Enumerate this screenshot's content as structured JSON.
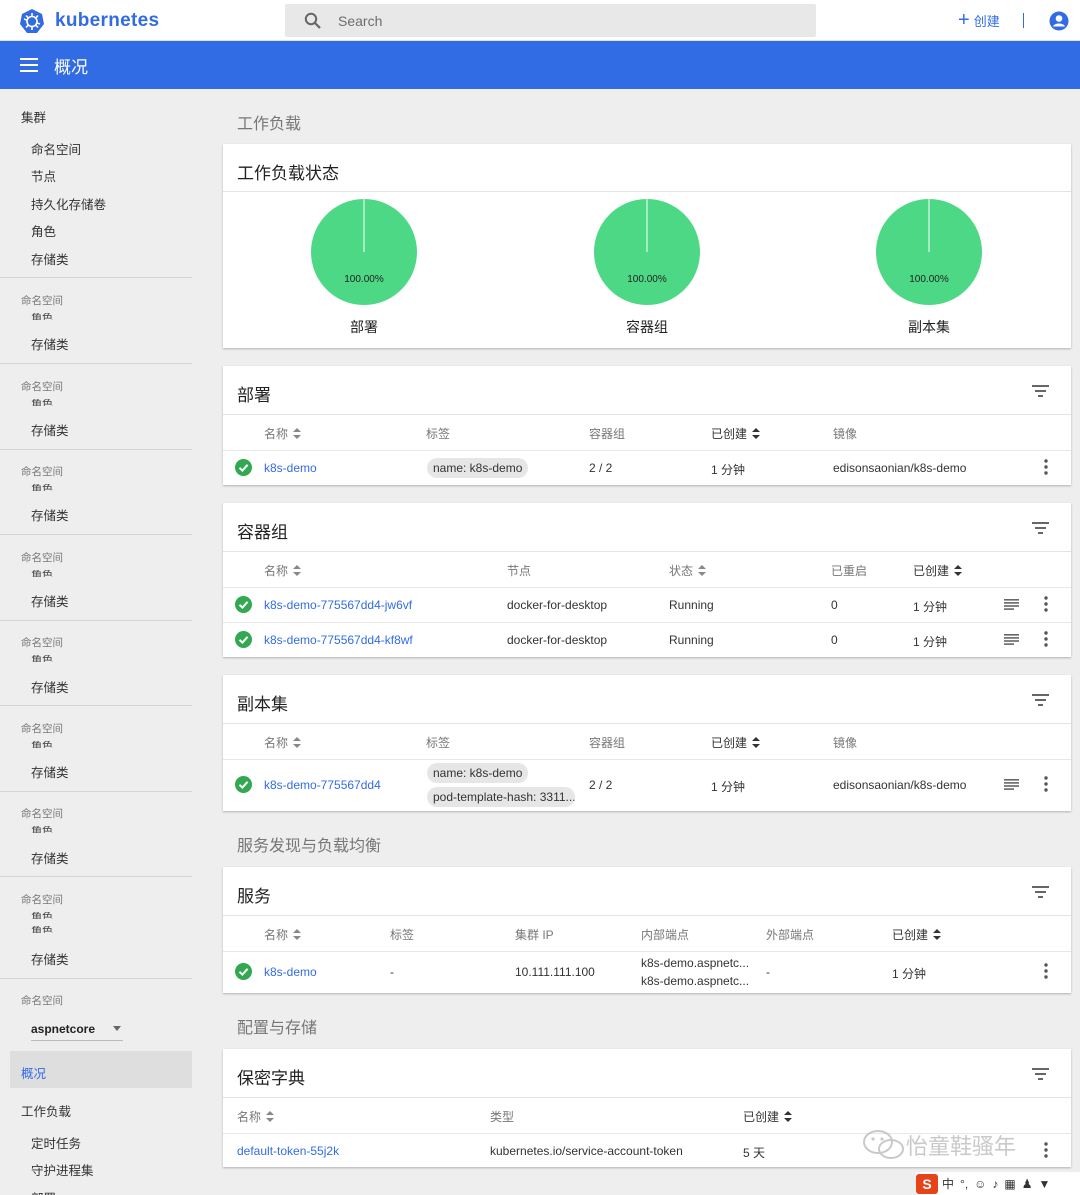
{
  "header": {
    "brand": "kubernetes",
    "search_placeholder": "Search",
    "create_label": "创建"
  },
  "toolbar": {
    "title": "概况"
  },
  "sidebar": {
    "cluster": "集群",
    "cluster_items": [
      "命名空间",
      "节点",
      "持久化存储卷",
      "角色",
      "存储类"
    ],
    "ns_label": "命名空间",
    "cut_item": "角色",
    "storage_item": "存储类",
    "namespace_value": "aspnetcore",
    "overview": "概况",
    "workloads": "工作负载",
    "workload_items": [
      "定时任务",
      "守护进程集",
      "部署"
    ]
  },
  "workloads": {
    "section": "工作负载",
    "status_card": {
      "title": "工作负载状态",
      "pies": [
        {
          "label": "部署",
          "pct": "100.00%",
          "value": 1.0
        },
        {
          "label": "容器组",
          "pct": "100.00%",
          "value": 1.0
        },
        {
          "label": "副本集",
          "pct": "100.00%",
          "value": 1.0
        }
      ]
    },
    "deployments": {
      "title": "部署",
      "headers": [
        "名称",
        "标签",
        "容器组",
        "已创建",
        "镜像"
      ],
      "rows": [
        {
          "name": "k8s-demo",
          "label": "name: k8s-demo",
          "pods": "2 / 2",
          "created": "1 分钟",
          "image": "edisonsaonian/k8s-demo"
        }
      ]
    },
    "pods": {
      "title": "容器组",
      "headers": [
        "名称",
        "节点",
        "状态",
        "已重启",
        "已创建"
      ],
      "rows": [
        {
          "name": "k8s-demo-775567dd4-jw6vf",
          "node": "docker-for-desktop",
          "status": "Running",
          "restarts": "0",
          "created": "1 分钟"
        },
        {
          "name": "k8s-demo-775567dd4-kf8wf",
          "node": "docker-for-desktop",
          "status": "Running",
          "restarts": "0",
          "created": "1 分钟"
        }
      ]
    },
    "replicasets": {
      "title": "副本集",
      "headers": [
        "名称",
        "标签",
        "容器组",
        "已创建",
        "镜像"
      ],
      "rows": [
        {
          "name": "k8s-demo-775567dd4",
          "label1": "name: k8s-demo",
          "label2": "pod-template-hash: 3311...",
          "pods": "2 / 2",
          "created": "1 分钟",
          "image": "edisonsaonian/k8s-demo"
        }
      ]
    }
  },
  "discovery": {
    "section": "服务发现与负载均衡",
    "services": {
      "title": "服务",
      "headers": [
        "名称",
        "标签",
        "集群 IP",
        "内部端点",
        "外部端点",
        "已创建"
      ],
      "rows": [
        {
          "name": "k8s-demo",
          "label": "-",
          "cluster_ip": "10.111.111.100",
          "internal1": "k8s-demo.aspnetc...",
          "internal2": "k8s-demo.aspnetc...",
          "external": "-",
          "created": "1 分钟"
        }
      ]
    }
  },
  "config": {
    "section": "配置与存储",
    "secrets": {
      "title": "保密字典",
      "headers": [
        "名称",
        "类型",
        "已创建"
      ],
      "rows": [
        {
          "name": "default-token-55j2k",
          "type": "kubernetes.io/service-account-token",
          "created": "5 天"
        }
      ]
    }
  },
  "watermark": "怡童鞋骚年",
  "ime": {
    "logo": "S",
    "mode": "中"
  },
  "colors": {
    "primary": "#326ce5",
    "success": "#32a852",
    "pie": "#4dd886"
  }
}
